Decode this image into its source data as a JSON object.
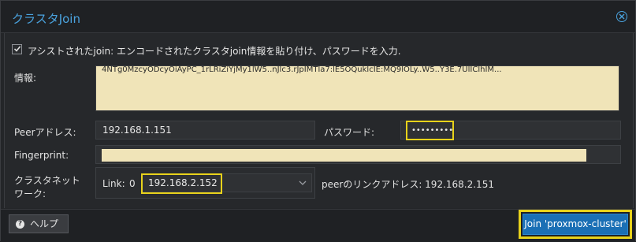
{
  "dialog": {
    "title": "クラスタJoin",
    "close_icon": "close-circle-icon"
  },
  "assisted": {
    "checked": true,
    "label": "アシストされたjoin: エンコードされたクラスタjoin情報を貼り付け、パスワードを入力."
  },
  "info": {
    "label": "情報:",
    "text": "4NTg0MzcyODcyOiAyPC_1rLRiZiYjMy1lW5..nJlc3.rJpIMTla7:lE5OQuklcIE:MQ9lOLy..W5..Y3E.7UlIClhIM..."
  },
  "peer": {
    "label": "Peerアドレス:",
    "value": "192.168.1.151"
  },
  "password": {
    "label": "パスワード:",
    "value": "•••••••••"
  },
  "fingerprint": {
    "label": "Fingerprint:"
  },
  "cluster_network": {
    "label_line1": "クラスタネット",
    "label_line2": "ワーク:",
    "link_label": "Link:",
    "link_number": "0",
    "link_value": "192.168.2.152",
    "peer_link_text": "peerのリンクアドレス: 192.168.2.151"
  },
  "footer": {
    "help_label": "ヘルプ",
    "help_icon": "question-circle-icon",
    "join_label": "Join 'proxmox-cluster'"
  },
  "colors": {
    "accent": "#4aa3df",
    "highlight": "#e8d21b",
    "redacted": "#f0e4b8",
    "primary_button": "#1a6fb5"
  }
}
